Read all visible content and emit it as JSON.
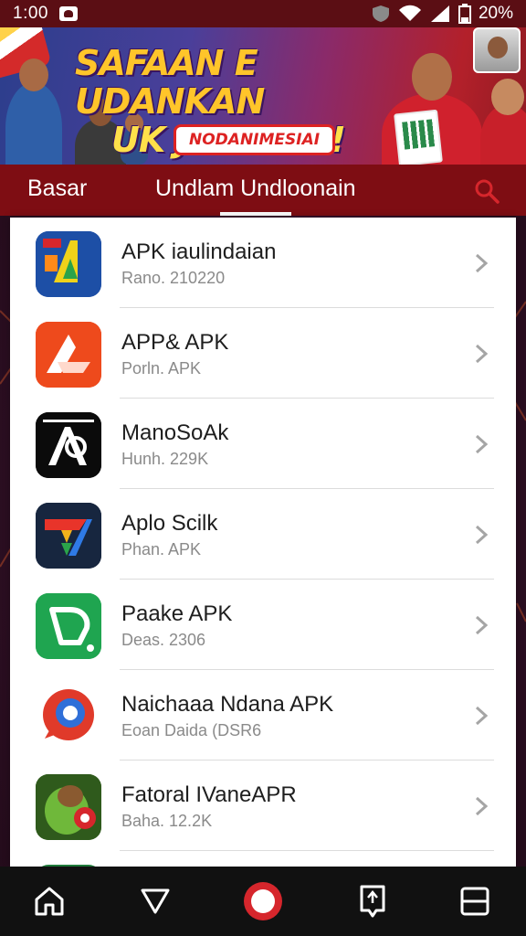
{
  "status_bar": {
    "time": "1:00",
    "battery": "20%"
  },
  "banner": {
    "headline_line1": "SAFAAN E UDANKAN",
    "headline_line2": "UK JAPRIAN!",
    "button_label": "NODANIMESIAI"
  },
  "tabs": {
    "basic_label": "Basar",
    "active_label": "Undlam Undloonain"
  },
  "apps": [
    {
      "name": "APK iaulindaian",
      "meta": "Rano. 210220",
      "icon": "app-icon-blue-a"
    },
    {
      "name": "APP& APK",
      "meta": "Porln. APK",
      "icon": "app-icon-orange-arrow"
    },
    {
      "name": "ManoSoAk",
      "meta": "Hunh. 229K",
      "icon": "app-icon-black-ap"
    },
    {
      "name": "Aplo Scilk",
      "meta": "Phan. APK",
      "icon": "app-icon-navy-colorful"
    },
    {
      "name": "Paake APK",
      "meta": "Deas. 2306",
      "icon": "app-icon-green-d"
    },
    {
      "name": "Naichaaa Ndana APK",
      "meta": "Eoan Daida (DSR6",
      "icon": "app-icon-chat-bubble"
    },
    {
      "name": "Fatoral IVaneAPR",
      "meta": "Baha. 12.2K",
      "icon": "app-icon-game-creature"
    }
  ],
  "colors": {
    "status_bar": "#5b0e14",
    "tab_bar": "#7e0d13",
    "accent_red": "#d6262c",
    "nav_bar": "#111111"
  },
  "bottom_nav": [
    "home-icon",
    "back-icon",
    "record-icon",
    "bookmark-icon",
    "recents-icon"
  ]
}
